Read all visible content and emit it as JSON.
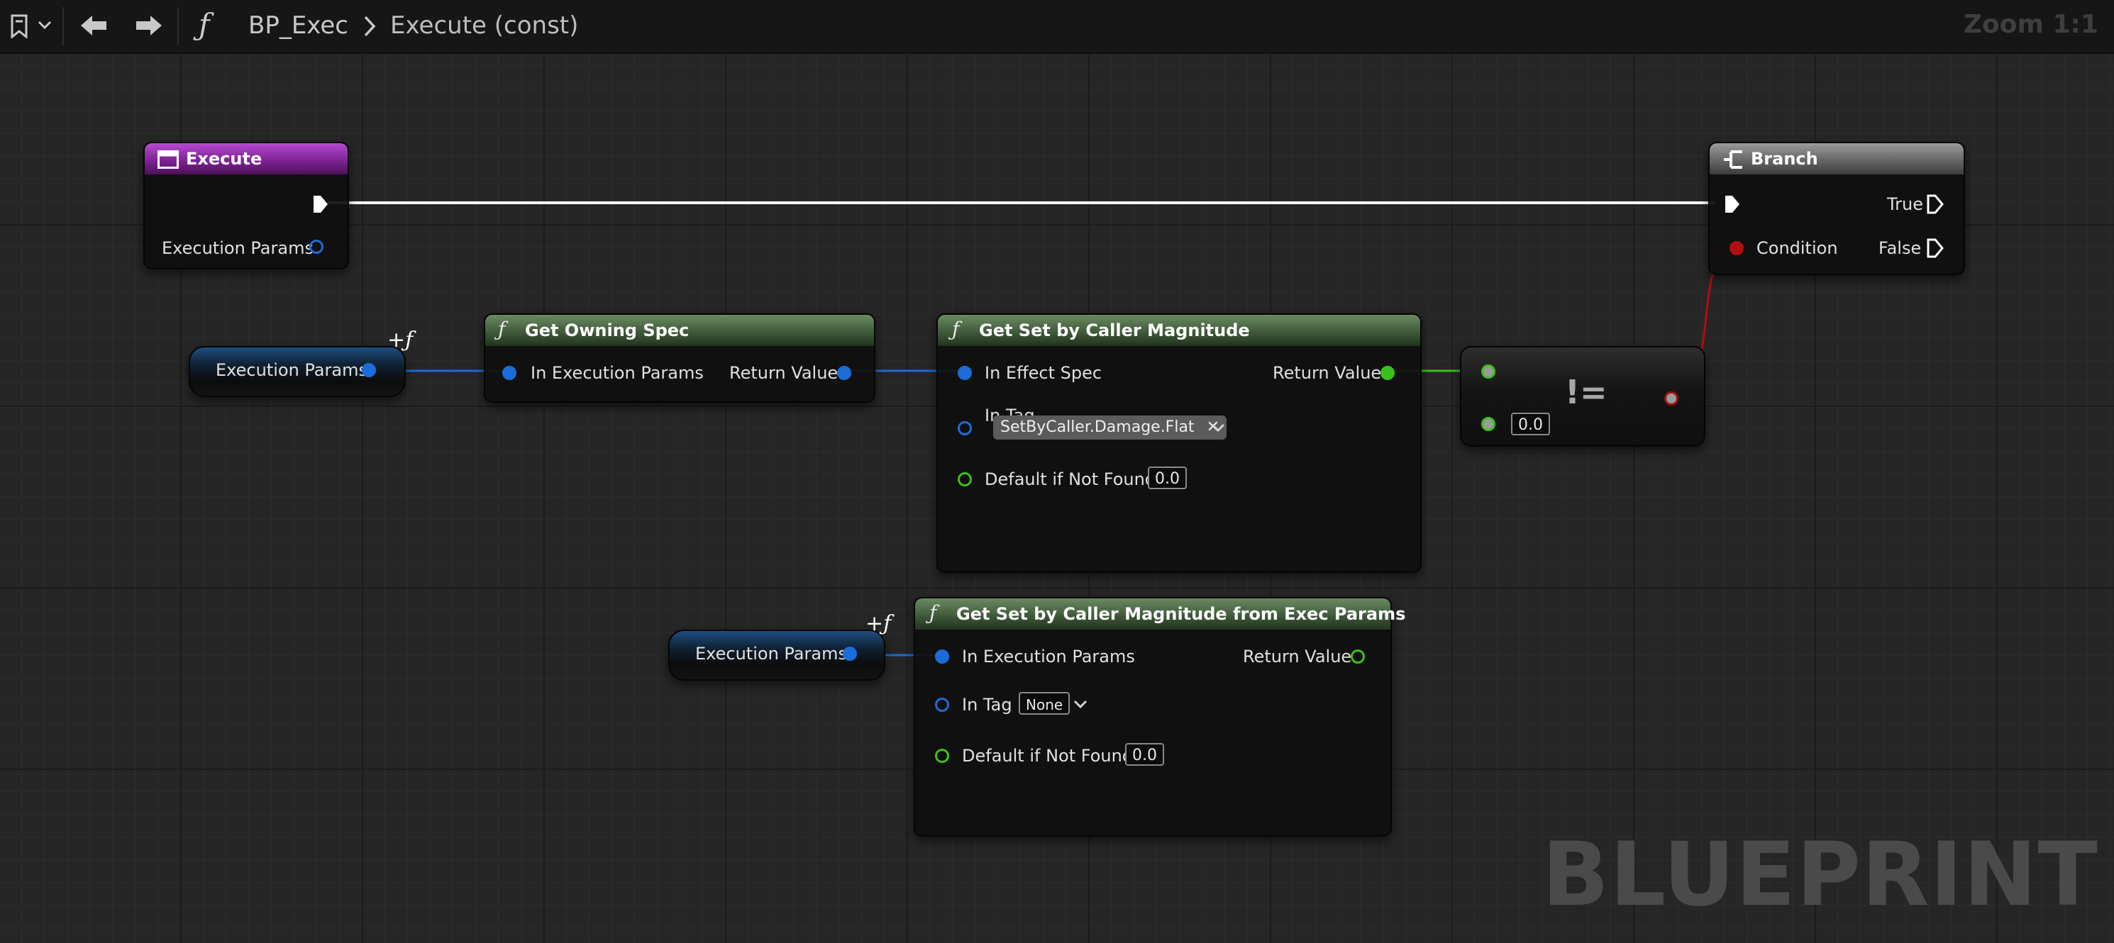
{
  "toolbar": {
    "breadcrumb_root": "BP_Exec",
    "breadcrumb_current": "Execute (const)",
    "zoom": "Zoom 1:1"
  },
  "watermark": "BLUEPRINT",
  "nodes": {
    "execute": {
      "title": "Execute",
      "pin_params": "Execution Params"
    },
    "branch": {
      "title": "Branch",
      "pin_condition": "Condition",
      "pin_true": "True",
      "pin_false": "False"
    },
    "var1": {
      "label": "Execution Params"
    },
    "get_owning_spec": {
      "title": "Get Owning Spec",
      "pin_in": "In Execution Params",
      "pin_out": "Return Value"
    },
    "get_sbc_mag": {
      "title": "Get Set by Caller Magnitude",
      "pin_spec": "In Effect Spec",
      "pin_tag": "In Tag",
      "tag_value": "SetByCaller.Damage.Flat",
      "pin_default": "Default if Not Found",
      "default_value": "0.0",
      "pin_out": "Return Value"
    },
    "not_equal": {
      "symbol": "!=",
      "b_value": "0.0"
    },
    "var2": {
      "label": "Execution Params"
    },
    "get_sbc_mag_exec": {
      "title": "Get Set by Caller Magnitude from Exec Params",
      "pin_in": "In Execution Params",
      "pin_tag": "In Tag",
      "tag_value": "None",
      "pin_default": "Default if Not Found",
      "default_value": "0.0",
      "pin_out": "Return Value"
    }
  },
  "colors": {
    "function_header": "#3b5636",
    "event_header": "#7a2190",
    "branch_header": "#626262",
    "struct_pin": "#1b6cd9",
    "float_pin": "#3bc21a",
    "bool_pin": "#b20e0e",
    "exec_wire": "#ffffff"
  }
}
